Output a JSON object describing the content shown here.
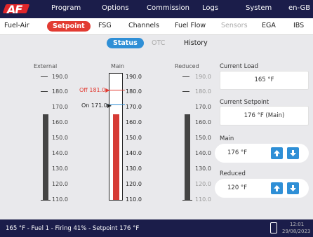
{
  "topbar": {
    "logo": "AF",
    "menu": [
      "Program",
      "Options",
      "Commission",
      "Logs",
      "System",
      "en-GB"
    ]
  },
  "tabs": [
    "Fuel-Air",
    "Setpoint",
    "FSG",
    "Channels",
    "Fuel Flow",
    "Sensors",
    "EGA",
    "IBS"
  ],
  "subtabs": [
    "Status",
    "OTC",
    "History"
  ],
  "gauges": {
    "external": {
      "label": "External",
      "ticks": [
        "190.0",
        "180.0",
        "170.0",
        "160.0",
        "150.0",
        "140.0",
        "130.0",
        "120.0",
        "110.0"
      ]
    },
    "main": {
      "label": "Main",
      "ticks": [
        "190.0",
        "180.0",
        "170.0",
        "160.0",
        "150.0",
        "140.0",
        "130.0",
        "120.0",
        "110.0"
      ],
      "off_label": "Off 181.0",
      "on_label": "On 171.0",
      "fill_value": 165
    },
    "reduced": {
      "label": "Reduced",
      "ticks": [
        "190.0",
        "180.0",
        "170.0",
        "160.0",
        "150.0",
        "140.0",
        "130.0",
        "120.0",
        "110.0"
      ]
    }
  },
  "right": {
    "current_load_label": "Current Load",
    "current_load_value": "165 °F",
    "current_setpoint_label": "Current Setpoint",
    "current_setpoint_value": "176 °F (Main)",
    "main_label": "Main",
    "main_value": "176 °F",
    "reduced_label": "Reduced",
    "reduced_value": "120 °F"
  },
  "bottom": {
    "status": "165 °F - Fuel 1 - Firing 41% - Setpoint 176 °F",
    "time": "12:01",
    "date": "29/08/2023"
  }
}
